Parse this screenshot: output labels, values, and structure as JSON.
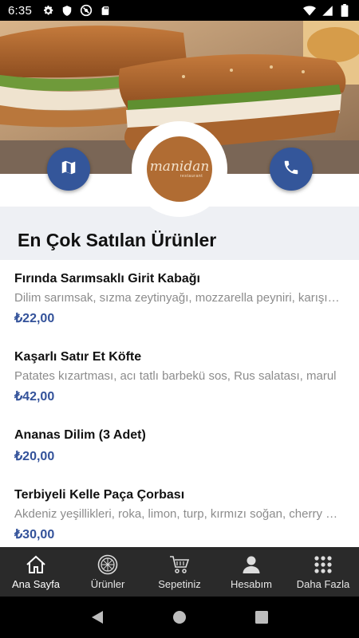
{
  "status_bar": {
    "time": "6:35",
    "icons": [
      "gear-icon",
      "shield-icon",
      "do-not-disturb-icon",
      "sd-card-icon",
      "wifi-icon",
      "signal-icon",
      "battery-icon"
    ]
  },
  "hero": {
    "image": "sandwich-photo",
    "logo": {
      "name": "manidan",
      "sub": "restaurant"
    },
    "left_button_icon": "map-icon",
    "right_button_icon": "phone-icon"
  },
  "section": {
    "title": "En Çok Satılan Ürünler"
  },
  "products": [
    {
      "name": "Fırında Sarımsaklı Girit Kabağı",
      "description": "Dilim sarımsak, sızma zeytinyağı, mozzarella peyniri, karışık yeşillik",
      "price": "₺22,00"
    },
    {
      "name": "Kaşarlı Satır Et Köfte",
      "description": "Patates kızartması, acı tatlı barbekü sos, Rus salatası, marul",
      "price": "₺42,00"
    },
    {
      "name": "Ananas Dilim (3 Adet)",
      "description": "",
      "price": "₺20,00"
    },
    {
      "name": "Terbiyeli Kelle Paça Çorbası",
      "description": "Akdeniz yeşillikleri, roka, limon, turp, kırmızı soğan, cherry domates",
      "price": "₺30,00"
    }
  ],
  "bottom_nav": [
    {
      "label": "Ana Sayfa",
      "icon": "home-icon",
      "active": true
    },
    {
      "label": "Ürünler",
      "icon": "pizza-icon",
      "active": false
    },
    {
      "label": "Sepetiniz",
      "icon": "cart-icon",
      "active": false
    },
    {
      "label": "Hesabım",
      "icon": "user-icon",
      "active": false
    },
    {
      "label": "Daha Fazla",
      "icon": "grid-icon",
      "active": false
    }
  ],
  "colors": {
    "accent": "#34569a",
    "price": "#33529a",
    "logo_bg": "#b06c33",
    "nav_bg": "#2a2a2a"
  }
}
